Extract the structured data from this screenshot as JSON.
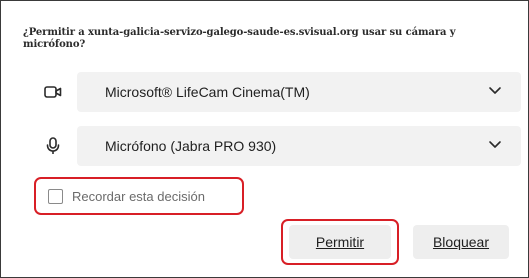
{
  "dialog": {
    "prompt": "¿Permitir a xunta-galicia-servizo-galego-saude-es.svisual.org usar su cámara y micrófono?",
    "camera": {
      "icon": "camera-icon",
      "selected": "Microsoft® LifeCam Cinema(TM)"
    },
    "microphone": {
      "icon": "microphone-icon",
      "selected": "Micrófono (Jabra PRO 930)"
    },
    "remember": {
      "label": "Recordar esta decisión",
      "checked": false
    },
    "buttons": {
      "allow": "Permitir",
      "block": "Bloquear"
    },
    "colors": {
      "highlight": "#d81f26",
      "select_bg": "#f2f2f2",
      "button_bg": "#eeeeee"
    }
  }
}
